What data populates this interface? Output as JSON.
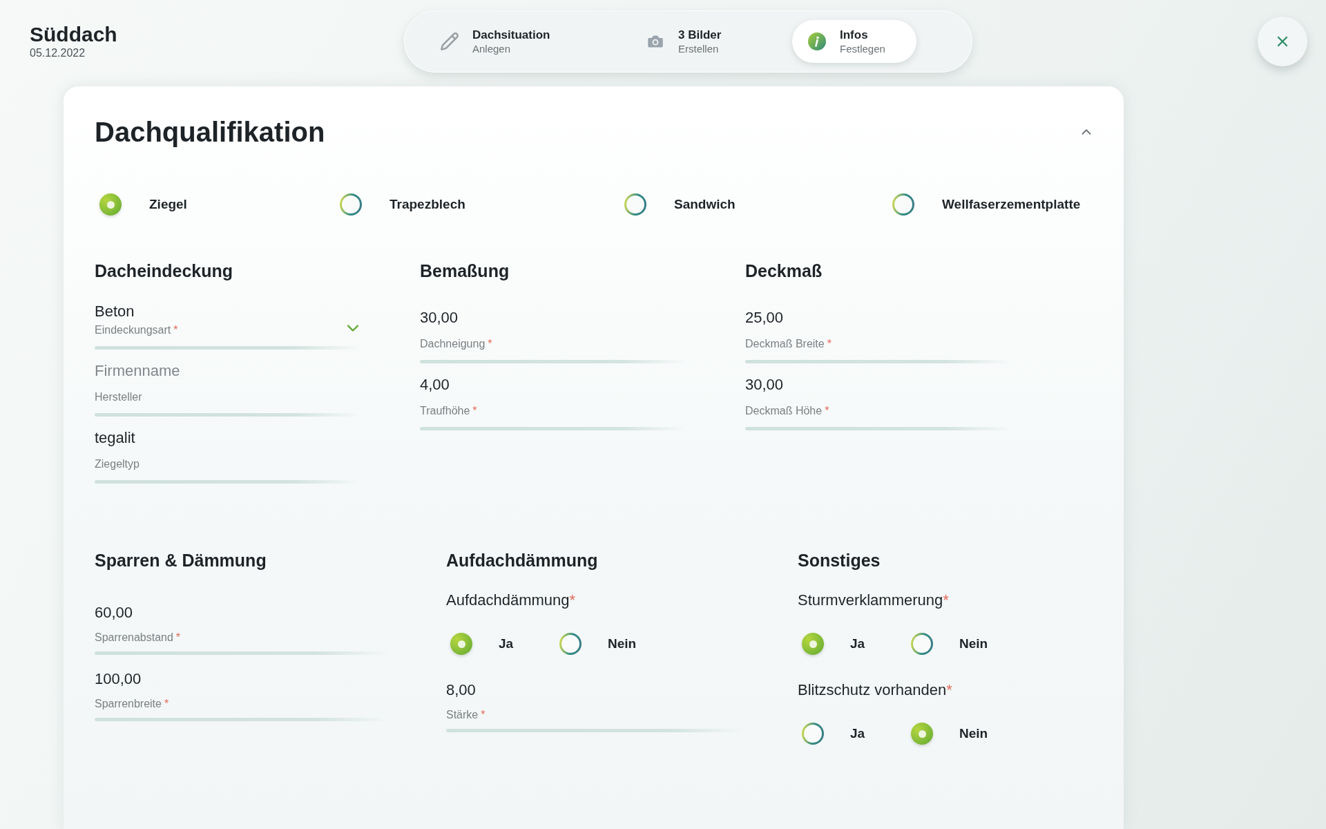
{
  "header": {
    "title": "Süddach",
    "date": "05.12.2022"
  },
  "steps": [
    {
      "title": "Dachsituation",
      "subtitle": "Anlegen",
      "selected": false
    },
    {
      "title": "3 Bilder",
      "subtitle": "Erstellen",
      "selected": false
    },
    {
      "title": "Infos",
      "subtitle": "Festlegen",
      "selected": true
    }
  ],
  "card": {
    "title": "Dachqualifikation",
    "expanded": true
  },
  "roof_types": [
    {
      "label": "Ziegel",
      "selected": true
    },
    {
      "label": "Trapezblech",
      "selected": false
    },
    {
      "label": "Sandwich",
      "selected": false
    },
    {
      "label": "Wellfaserzementplatte",
      "selected": false
    }
  ],
  "upper_sections": [
    {
      "heading": "Dacheindeckung",
      "items": [
        {
          "kind": "select",
          "value": "Beton",
          "label": "Eindeckungsart",
          "required_mark": "*"
        },
        {
          "kind": "input",
          "placeholder": "Firmenname",
          "label": "Hersteller"
        },
        {
          "kind": "input",
          "value": "tegalit",
          "label": "Ziegeltyp"
        }
      ]
    },
    {
      "heading": "Bemaßung",
      "items": [
        {
          "kind": "input",
          "value": "30,00",
          "label": "Dachneigung",
          "required_mark": "*"
        },
        {
          "kind": "input",
          "value": "4,00",
          "label": "Traufhöhe",
          "required_mark": "*"
        }
      ]
    },
    {
      "heading": "Deckmaß",
      "items": [
        {
          "kind": "input",
          "value": "25,00",
          "label": "Deckmaß Breite",
          "required_mark": "*"
        },
        {
          "kind": "input",
          "value": "30,00",
          "label": "Deckmaß Höhe",
          "required_mark": "*"
        }
      ]
    }
  ],
  "lower_sections": [
    {
      "heading": "Sparren & Dämmung",
      "items": [
        {
          "kind": "input",
          "value": "60,00",
          "label": "Sparrenabstand",
          "required_mark": "*"
        },
        {
          "kind": "input",
          "value": "100,00",
          "label": "Sparrenbreite",
          "required_mark": "*"
        }
      ]
    },
    {
      "heading": "Aufdachdämmung",
      "items": [
        {
          "kind": "radio_group",
          "question": "Aufdachdämmung",
          "required_mark": "*",
          "options": [
            {
              "label": "Ja",
              "selected": true
            },
            {
              "label": "Nein",
              "selected": false
            }
          ]
        },
        {
          "kind": "input",
          "value": "8,00",
          "label": "Stärke",
          "required_mark": "*"
        }
      ]
    },
    {
      "heading": "Sonstiges",
      "items": [
        {
          "kind": "radio_group",
          "question": "Sturmverklammerung",
          "required_mark": "*",
          "options": [
            {
              "label": "Ja",
              "selected": true
            },
            {
              "label": "Nein",
              "selected": false
            }
          ]
        },
        {
          "kind": "radio_group",
          "question": "Blitzschutz vorhanden",
          "required_mark": "*",
          "options": [
            {
              "label": "Ja",
              "selected": false
            },
            {
              "label": "Nein",
              "selected": true
            }
          ]
        }
      ]
    }
  ]
}
